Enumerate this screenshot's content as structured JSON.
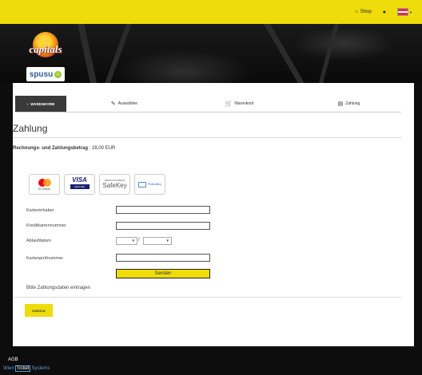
{
  "header": {
    "shop_label": "Shop",
    "shop_icon": "home-icon",
    "account_icon": "user-icon",
    "language_icon": "austria-flag-icon",
    "flag_colors": [
      "#ed2939",
      "#ffffff",
      "#ed2939"
    ]
  },
  "brand": {
    "logo_text": "capitals",
    "sponsor_text": "spusu"
  },
  "steps": {
    "back_label": "WARENKORB",
    "items": [
      {
        "label": "Auswählen",
        "icon": "pencil-icon"
      },
      {
        "label": "Warenkorb",
        "icon": "cart-icon"
      },
      {
        "label": "Zahlung",
        "icon": "card-icon"
      }
    ]
  },
  "page": {
    "title": "Zahlung",
    "amount_label": "Rechnungs- und Zahlungsbetrag",
    "amount_value": ": 28,00 EUR"
  },
  "badges": {
    "mastercard_caption": "ID Check",
    "visa_text": "VISA",
    "visa_sub": "SECURE",
    "safekey_top": "AMERICAN EXPRESS",
    "safekey_text": "SafeKey",
    "protectbuy_text": "ProtectBuy"
  },
  "form": {
    "holder_label": "Karteninhaber",
    "number_label": "Kreditkartennummer",
    "expiry_label": "Ablaufdatum",
    "expiry_separator": "/",
    "cvc_label": "Kartenprüfnummer",
    "submit_label": "Senden",
    "hint": "Bitte Zahlungsdaten eintragen"
  },
  "back_button": "ZURÜCK",
  "footer": {
    "title": "AGB",
    "brand_wien": "Wien",
    "brand_ticket": "Ticket",
    "brand_systems": "Systems"
  },
  "colors": {
    "accent_yellow": "#eedc0b",
    "dark": "#0d0d0d",
    "brand_blue": "#5b9bd5"
  }
}
